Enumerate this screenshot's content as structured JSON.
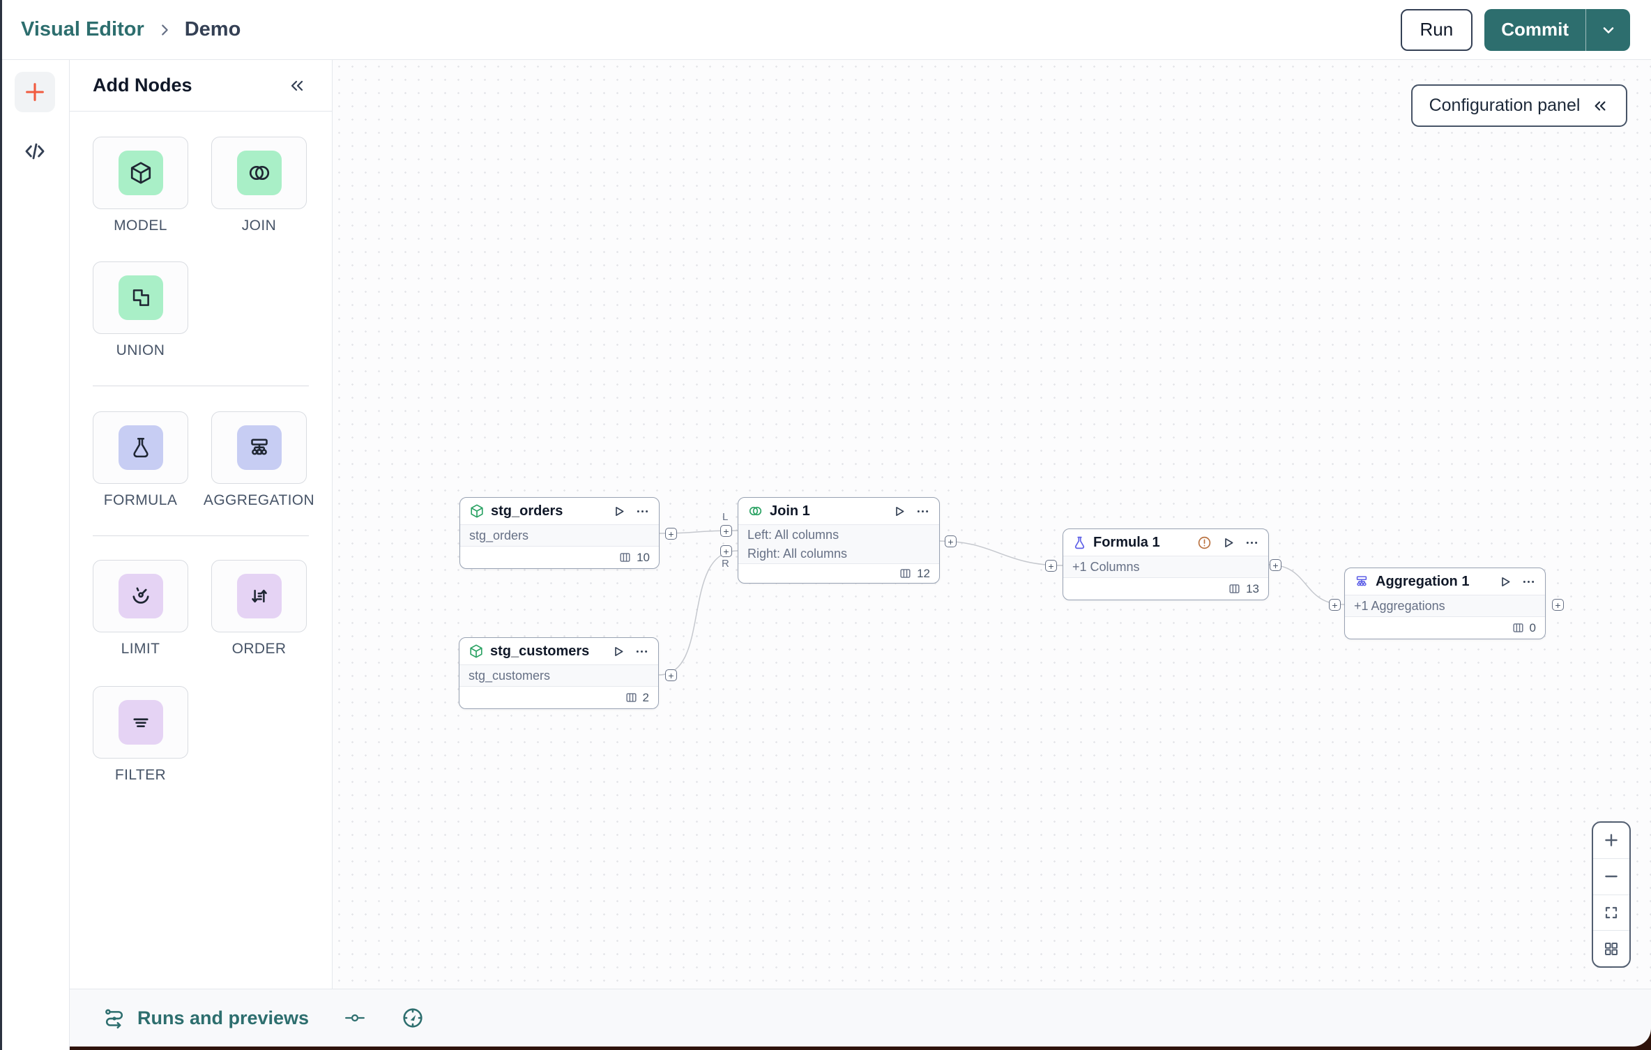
{
  "colors": {
    "teal": "#2d6e6e",
    "tile_green": "#a9efc7",
    "tile_indigo": "#c7cdf3",
    "tile_purple": "#e5d3f4",
    "node_green": "#2aa263",
    "node_indigo": "#5d5fe7",
    "warning_orange": "#b9713f",
    "accent_orange": "#f15b3f"
  },
  "topbar": {
    "breadcrumb_root": "Visual Editor",
    "breadcrumb_current": "Demo",
    "run_label": "Run",
    "commit_label": "Commit"
  },
  "panel": {
    "title": "Add Nodes",
    "tiles": [
      {
        "label": "MODEL"
      },
      {
        "label": "JOIN"
      },
      {
        "label": "UNION"
      },
      {
        "label": "FORMULA"
      },
      {
        "label": "AGGREGATION"
      },
      {
        "label": "LIMIT"
      },
      {
        "label": "ORDER"
      },
      {
        "label": "FILTER"
      }
    ]
  },
  "canvas": {
    "config_button_label": "Configuration panel",
    "port_plus": "+",
    "nodes": [
      {
        "title": "stg_orders",
        "body_lines": [
          "stg_orders"
        ],
        "columns": "10"
      },
      {
        "title": "stg_customers",
        "body_lines": [
          "stg_customers"
        ],
        "columns": "2"
      },
      {
        "title": "Join 1",
        "body_lines": [
          "Left: All columns",
          "Right: All columns"
        ],
        "columns": "12",
        "left_port_label": "L",
        "right_port_label": "R"
      },
      {
        "title": "Formula 1",
        "body_lines": [
          "+1 Columns"
        ],
        "columns": "13"
      },
      {
        "title": "Aggregation 1",
        "body_lines": [
          "+1 Aggregations"
        ],
        "columns": "0"
      }
    ]
  },
  "bottombar": {
    "runs_label": "Runs and previews"
  }
}
